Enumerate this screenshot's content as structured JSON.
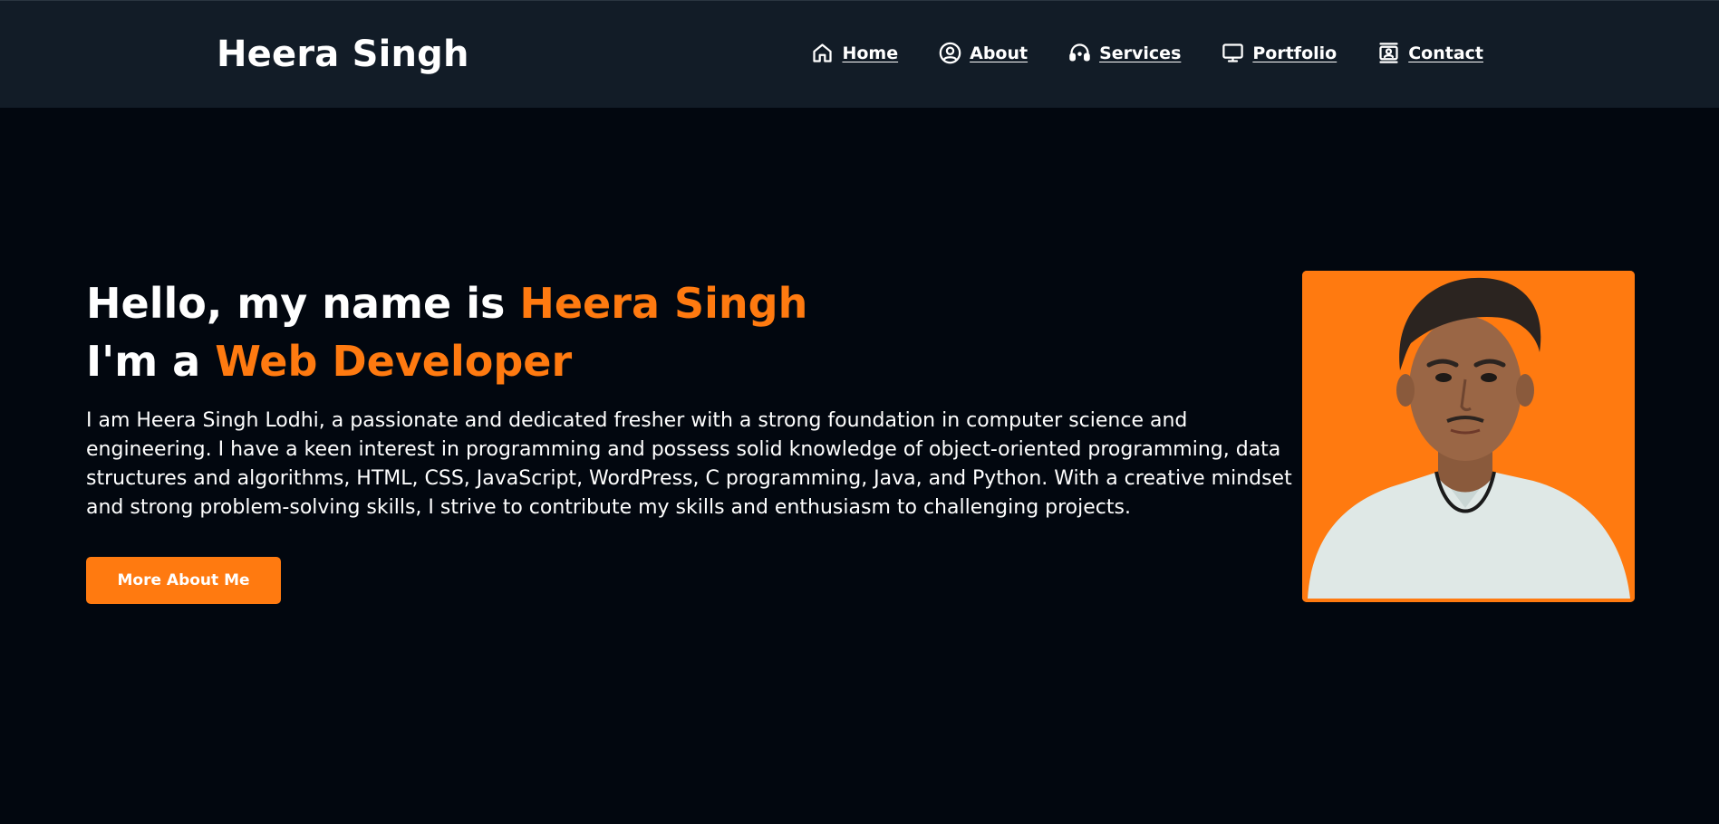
{
  "brand": "Heera Singh",
  "nav": {
    "items": [
      {
        "label": "Home",
        "icon": "home-icon"
      },
      {
        "label": "About",
        "icon": "user-circle-icon"
      },
      {
        "label": "Services",
        "icon": "headset-icon"
      },
      {
        "label": "Portfolio",
        "icon": "monitor-icon"
      },
      {
        "label": "Contact",
        "icon": "contact-card-icon"
      }
    ]
  },
  "hero": {
    "greeting_prefix": "Hello, my name is ",
    "name": "Heera Singh",
    "role_prefix": "I'm a ",
    "role": "Web Developer",
    "bio": "I am Heera Singh Lodhi, a passionate and dedicated fresher with a strong foundation in computer science and engineering. I have a keen interest in programming and possess solid knowledge of object-oriented programming, data structures and algorithms, HTML, CSS, JavaScript, WordPress, C programming, Java, and Python. With a creative mindset and strong problem-solving skills, I strive to contribute my skills and enthusiasm to challenging projects.",
    "button_label": "More About Me"
  },
  "colors": {
    "accent": "#ff7a10",
    "navbar_bg": "#121c27",
    "page_bg": "#02070f"
  }
}
